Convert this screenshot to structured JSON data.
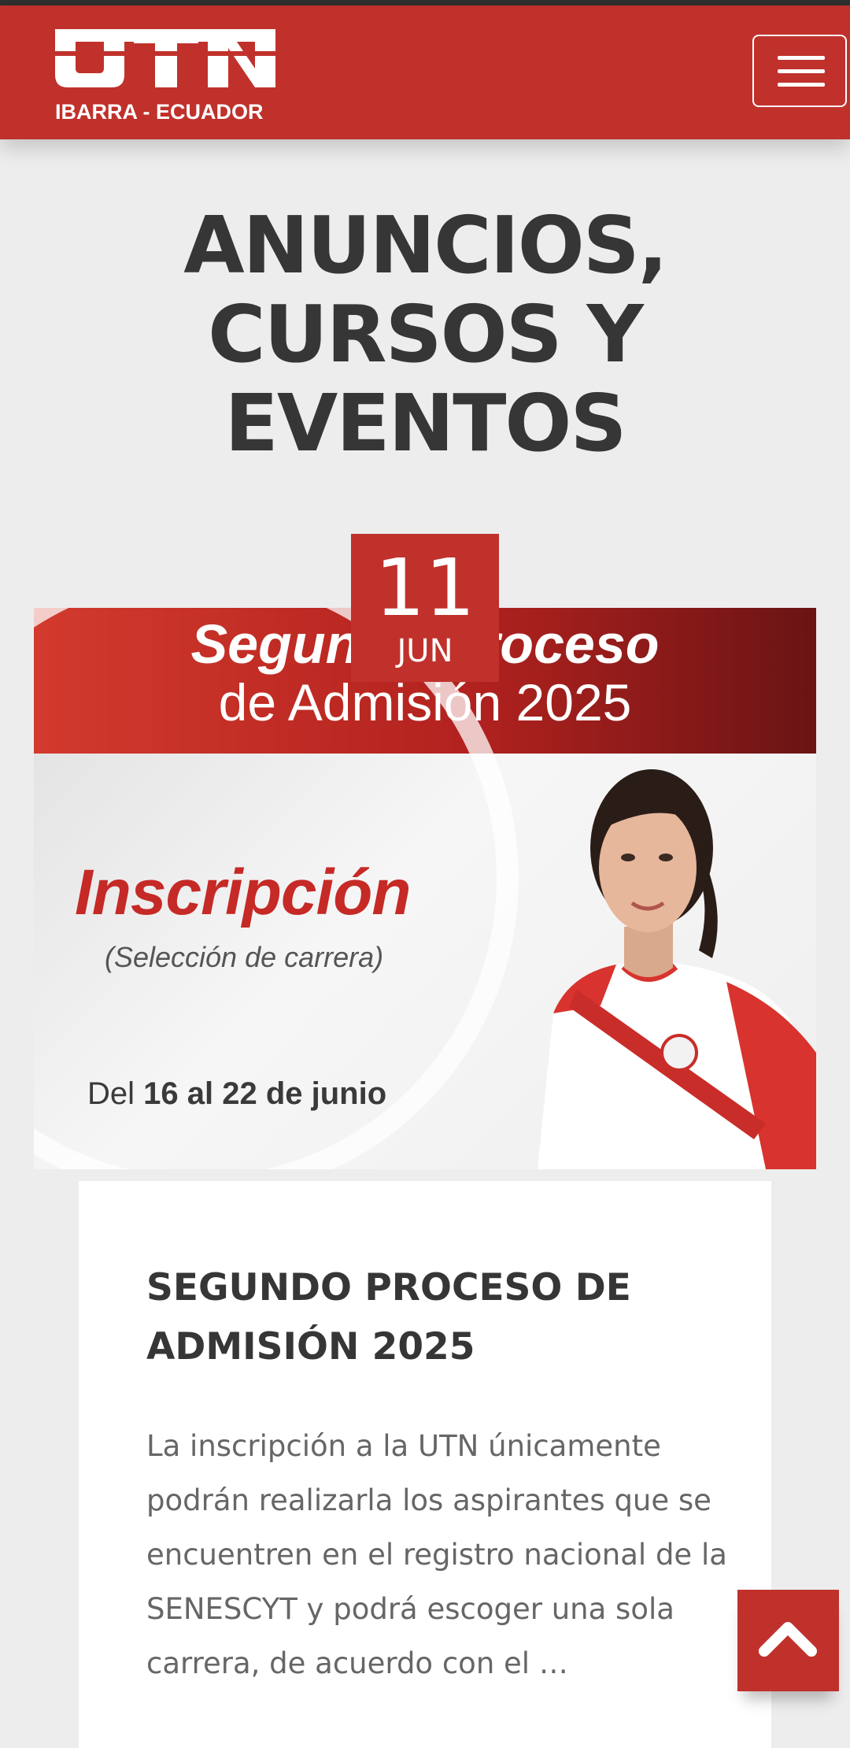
{
  "header": {
    "logo_text": "UTN",
    "logo_subtitle": "IBARRA - ECUADOR",
    "menu_icon": "hamburger-icon"
  },
  "page": {
    "title": "ANUNCIOS, CURSOS Y EVENTOS"
  },
  "event": {
    "date_day": "11",
    "date_month": "JUN",
    "banner": {
      "line1": "Segundo Proceso",
      "line2": "de Admisión 2025",
      "heading": "Inscripción",
      "subheading": "(Selección de carrera)",
      "dates_prefix": "Del",
      "dates_value": "16 al 22 de junio"
    },
    "title": "SEGUNDO PROCESO DE ADMISIÓN 2025",
    "excerpt": "La inscripción a la UTN únicamente podrán realizarla los aspirantes que se encuentren en el registro nacional de la SENESCYT y podrá escoger una sola carrera, de acuerdo con el …"
  },
  "back_to_top": {
    "icon": "chevron-up-icon"
  },
  "colors": {
    "brand_red": "#c0312c",
    "background": "#ededed",
    "title_text": "#363636",
    "body_text": "#666666"
  }
}
